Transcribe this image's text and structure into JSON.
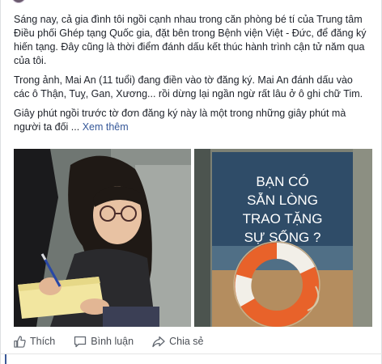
{
  "post": {
    "paragraphs": [
      "Sáng nay, cả gia đình tôi ngồi cạnh nhau trong căn phòng bé tí của Trung tâm Điều phối Ghép tạng Quốc gia, đặt bên trong Bệnh viện Việt - Đức, để đăng ký hiến tạng. Đây cũng là thời điểm đánh dấu kết thúc hành trình cận tử năm qua của tôi.",
      "Trong ảnh, Mai An (11 tuổi) đang điền vào tờ đăng ký. Mai An đánh dấu vào các ô Thận, Tuỵ, Gan, Xương... rồi dừng lại ngần ngừ rất lâu ở ô ghi chữ Tim.",
      "Giây phút ngồi trước tờ đơn đăng ký này là một trong những giây phút mà người ta đối ..."
    ],
    "see_more": "Xem thêm"
  },
  "photos": {
    "poster_lines": [
      "BẠN CÓ",
      "SẴN LÒNG",
      "TRAO TẶNG",
      "SỰ SỐNG ?"
    ]
  },
  "actions": {
    "like": "Thích",
    "comment": "Bình luận",
    "share": "Chia sẻ"
  },
  "icons": {
    "like": "thumbs-up-icon",
    "comment": "speech-bubble-icon",
    "share": "share-arrow-icon"
  },
  "colors": {
    "link": "#365899",
    "text": "#1d2129",
    "action_text": "#4b4f56",
    "poster_bg": "#2f4c68",
    "life_ring": "#e8622a"
  }
}
